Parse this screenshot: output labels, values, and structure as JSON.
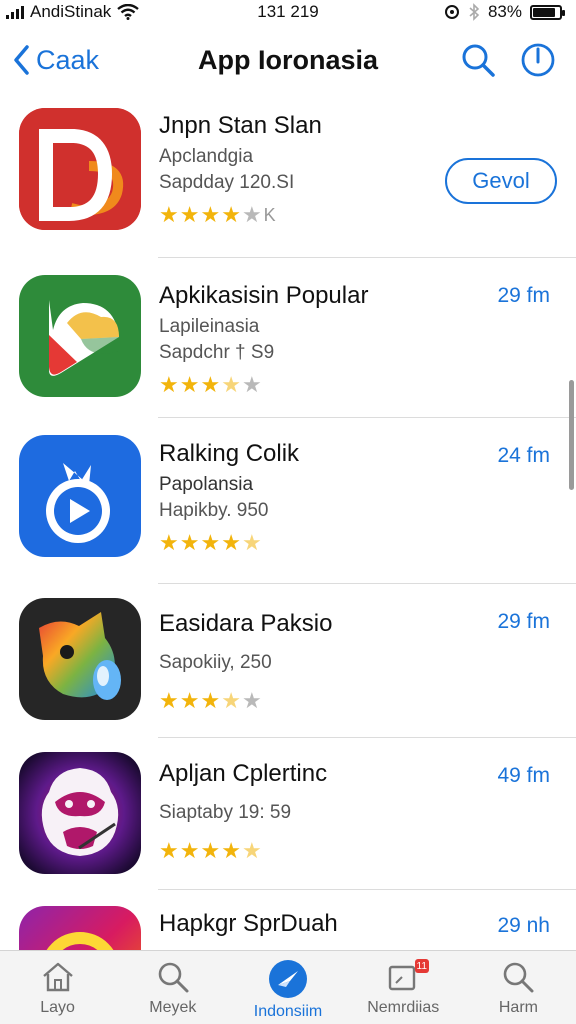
{
  "status_bar": {
    "carrier": "AndiStinak",
    "time": "131 219",
    "battery_text": "83%",
    "battery_level": 0.83
  },
  "nav": {
    "back_label": "Caak",
    "title": "App Ioronasia"
  },
  "apps": [
    {
      "name": "Jnpn Stan Slan",
      "subtitle": "Apclandgia",
      "meta": "Sapdday 120.SI",
      "rating": 4,
      "rating_suffix": "K",
      "action": "button",
      "button_label": "Gevol",
      "icon": "red-d-icon",
      "icon_color": "#d32f2f"
    },
    {
      "name": "Apkikasisin Popular",
      "subtitle": "Lapileinasia",
      "meta": "Sapdchr † S9",
      "rating": 3.5,
      "rating_suffix": "",
      "action": "size",
      "size": "29 fm",
      "icon": "green-leaf-icon",
      "icon_color": "#2e8b3a"
    },
    {
      "name": "Ralking Colik",
      "subtitle": "Papolansia",
      "meta": "Hapikby. 950",
      "rating": 4.5,
      "rating_suffix": "",
      "action": "size",
      "size": "24 fm",
      "icon": "blue-play-icon",
      "icon_color": "#1e6be0"
    },
    {
      "name": "Easidara Paksio",
      "subtitle": "",
      "meta": "Sapokiiy, 250",
      "rating": 3.5,
      "rating_suffix": "",
      "action": "size",
      "size": "29 fm",
      "icon": "colorful-bird-icon",
      "icon_color": "#2b2b2b"
    },
    {
      "name": "Apljan Cplertinc",
      "subtitle": "",
      "meta": "Siaptaby 19: 59",
      "rating": 4.5,
      "rating_suffix": "",
      "action": "size",
      "size": "49 fm",
      "icon": "purple-face-icon",
      "icon_color": "#3a0e5e"
    },
    {
      "name": "Hapkgr SprDuah",
      "subtitle": "",
      "meta": "",
      "rating": 0,
      "rating_suffix": "",
      "action": "size",
      "size": "29 nh",
      "icon": "gradient-ring-icon",
      "icon_color": "#8e24aa"
    }
  ],
  "tabs": [
    {
      "label": "Layo",
      "icon": "home-icon",
      "active": false
    },
    {
      "label": "Meyek",
      "icon": "search-icon",
      "active": false
    },
    {
      "label": "Indonsiim",
      "icon": "compass-icon",
      "active": true
    },
    {
      "label": "Nemrdiias",
      "icon": "updates-icon",
      "active": false,
      "badge": "11"
    },
    {
      "label": "Harm",
      "icon": "search-icon",
      "active": false
    }
  ],
  "colors": {
    "accent": "#1a73d9",
    "star": "#f2b40c",
    "divider": "#dcdcdc"
  }
}
